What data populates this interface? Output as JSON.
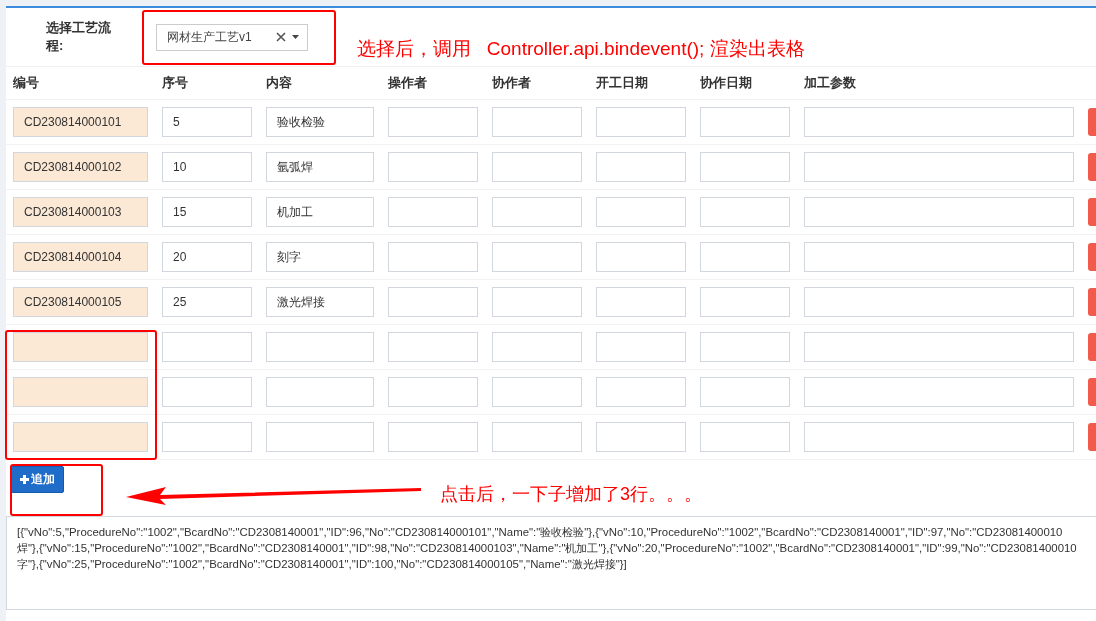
{
  "process_select": {
    "label": "选择工艺流程:",
    "value": "网材生产工艺v1"
  },
  "columns": [
    "编号",
    "序号",
    "内容",
    "操作者",
    "协作者",
    "开工日期",
    "协作日期",
    "加工参数"
  ],
  "rows": [
    {
      "no": "CD230814000101",
      "seq": "5",
      "content": "验收检验"
    },
    {
      "no": "CD230814000102",
      "seq": "10",
      "content": "氩弧焊"
    },
    {
      "no": "CD230814000103",
      "seq": "15",
      "content": "机加工"
    },
    {
      "no": "CD230814000104",
      "seq": "20",
      "content": "刻字"
    },
    {
      "no": "CD230814000105",
      "seq": "25",
      "content": "激光焊接"
    },
    {},
    {},
    {}
  ],
  "add_button": {
    "label": "追加"
  },
  "output_lines": [
    "[{\"vNo\":5,\"ProcedureNo\":\"1002\",\"BcardNo\":\"CD2308140001\",\"ID\":96,\"No\":\"CD230814000101\",\"Name\":\"验收检验\"},{\"vNo\":10,\"ProcedureNo\":\"1002\",\"BcardNo\":\"CD2308140001\",\"ID\":97,\"No\":\"CD23081400010",
    "焊\"},{\"vNo\":15,\"ProcedureNo\":\"1002\",\"BcardNo\":\"CD2308140001\",\"ID\":98,\"No\":\"CD230814000103\",\"Name\":\"机加工\"},{\"vNo\":20,\"ProcedureNo\":\"1002\",\"BcardNo\":\"CD2308140001\",\"ID\":99,\"No\":\"CD23081400010",
    "字\"},{\"vNo\":25,\"ProcedureNo\":\"1002\",\"BcardNo\":\"CD2308140001\",\"ID\":100,\"No\":\"CD230814000105\",\"Name\":\"激光焊接\"}]"
  ],
  "annotations": [
    {
      "text": "选择后，调用   Controller.api.bindevent(); 渲染出表格"
    },
    {
      "text": "点击后，一下子增加了3行。。。"
    }
  ]
}
